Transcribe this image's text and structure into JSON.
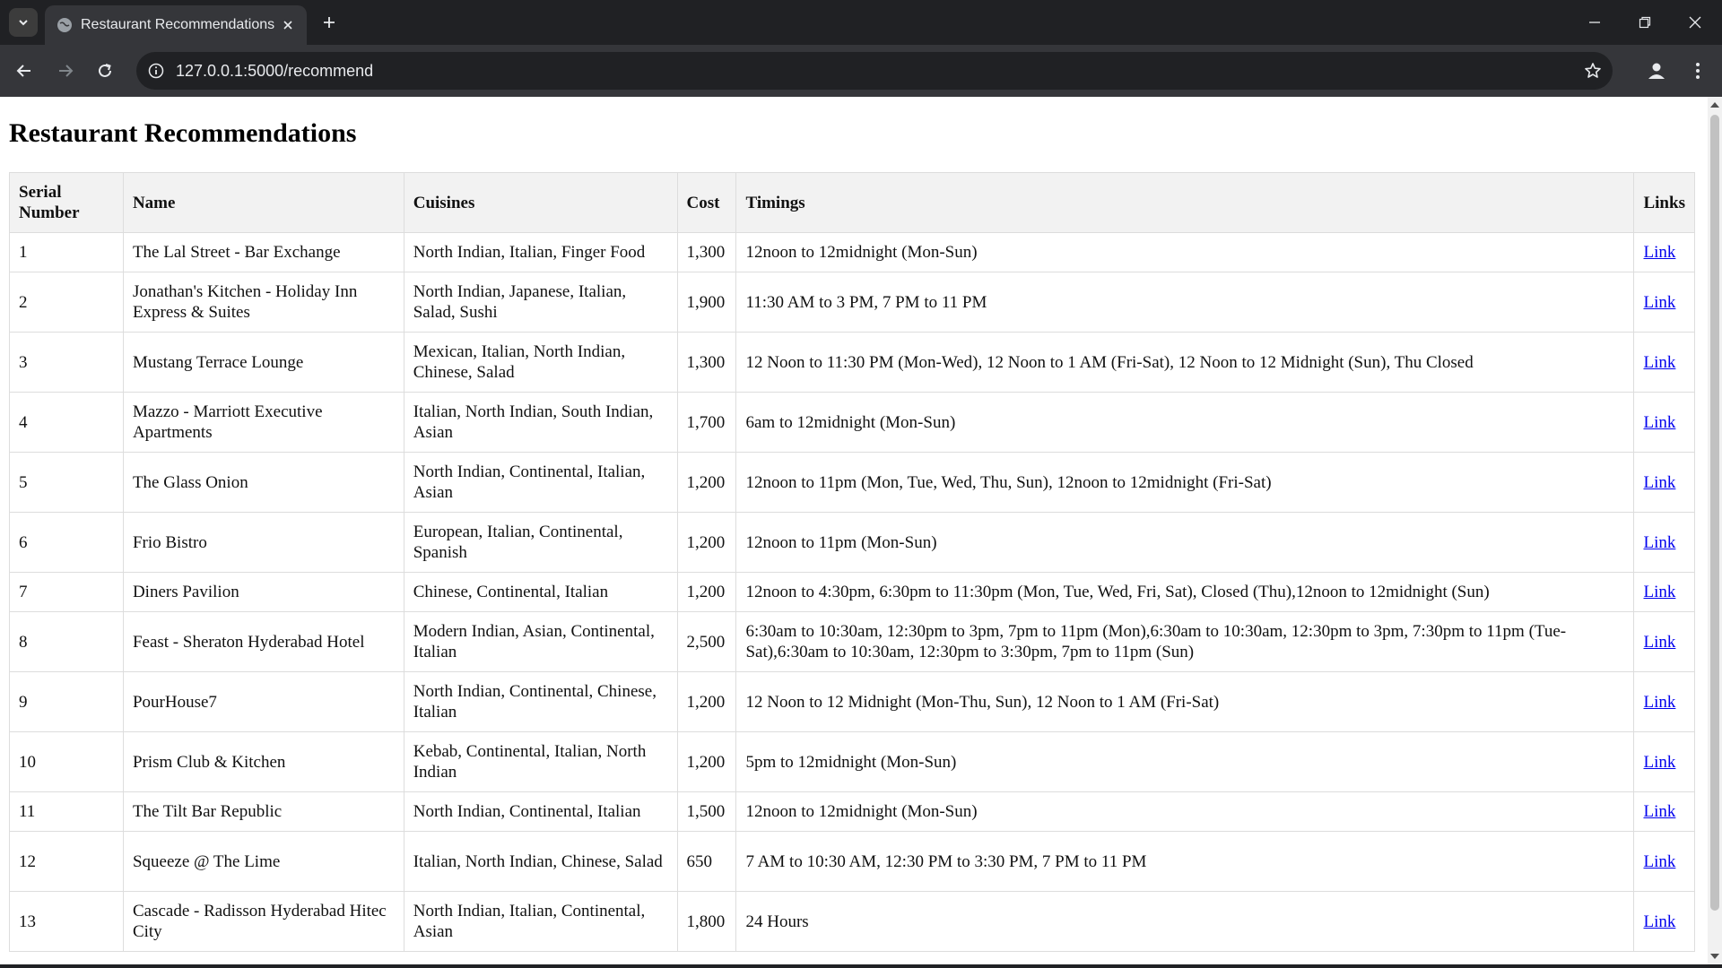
{
  "browser": {
    "tab_title": "Restaurant Recommendations",
    "url": "127.0.0.1:5000/recommend"
  },
  "page": {
    "title": "Restaurant Recommendations",
    "headers": {
      "serial": "Serial Number",
      "name": "Name",
      "cuisines": "Cuisines",
      "cost": "Cost",
      "timings": "Timings",
      "links": "Links"
    },
    "link_label": "Link",
    "rows": [
      {
        "serial": "1",
        "name": "The Lal Street - Bar Exchange",
        "cuisines": "North Indian, Italian, Finger Food",
        "cost": "1,300",
        "timings": "12noon to 12midnight (Mon-Sun)"
      },
      {
        "serial": "2",
        "name": "Jonathan's Kitchen - Holiday Inn Express & Suites",
        "cuisines": "North Indian, Japanese, Italian, Salad, Sushi",
        "cost": "1,900",
        "timings": "11:30 AM to 3 PM, 7 PM to 11 PM"
      },
      {
        "serial": "3",
        "name": "Mustang Terrace Lounge",
        "cuisines": "Mexican, Italian, North Indian, Chinese, Salad",
        "cost": "1,300",
        "timings": "12 Noon to 11:30 PM (Mon-Wed), 12 Noon to 1 AM (Fri-Sat), 12 Noon to 12 Midnight (Sun), Thu Closed"
      },
      {
        "serial": "4",
        "name": "Mazzo - Marriott Executive Apartments",
        "cuisines": "Italian, North Indian, South Indian, Asian",
        "cost": "1,700",
        "timings": "6am to 12midnight (Mon-Sun)"
      },
      {
        "serial": "5",
        "name": "The Glass Onion",
        "cuisines": "North Indian, Continental, Italian, Asian",
        "cost": "1,200",
        "timings": "12noon to 11pm (Mon, Tue, Wed, Thu, Sun), 12noon to 12midnight (Fri-Sat)"
      },
      {
        "serial": "6",
        "name": "Frio Bistro",
        "cuisines": "European, Italian, Continental, Spanish",
        "cost": "1,200",
        "timings": "12noon to 11pm (Mon-Sun)"
      },
      {
        "serial": "7",
        "name": "Diners Pavilion",
        "cuisines": "Chinese, Continental, Italian",
        "cost": "1,200",
        "timings": "12noon to 4:30pm, 6:30pm to 11:30pm (Mon, Tue, Wed, Fri, Sat), Closed (Thu),12noon to 12midnight (Sun)"
      },
      {
        "serial": "8",
        "name": "Feast - Sheraton Hyderabad Hotel",
        "cuisines": "Modern Indian, Asian, Continental, Italian",
        "cost": "2,500",
        "timings": "6:30am to 10:30am, 12:30pm to 3pm, 7pm to 11pm (Mon),6:30am to 10:30am, 12:30pm to 3pm, 7:30pm to 11pm (Tue-Sat),6:30am to 10:30am, 12:30pm to 3:30pm, 7pm to 11pm (Sun)"
      },
      {
        "serial": "9",
        "name": "PourHouse7",
        "cuisines": "North Indian, Continental, Chinese, Italian",
        "cost": "1,200",
        "timings": "12 Noon to 12 Midnight (Mon-Thu, Sun), 12 Noon to 1 AM (Fri-Sat)"
      },
      {
        "serial": "10",
        "name": "Prism Club & Kitchen",
        "cuisines": "Kebab, Continental, Italian, North Indian",
        "cost": "1,200",
        "timings": "5pm to 12midnight (Mon-Sun)"
      },
      {
        "serial": "11",
        "name": "The Tilt Bar Republic",
        "cuisines": "North Indian, Continental, Italian",
        "cost": "1,500",
        "timings": "12noon to 12midnight (Mon-Sun)"
      },
      {
        "serial": "12",
        "name": "Squeeze @ The Lime",
        "cuisines": "Italian, North Indian, Chinese, Salad",
        "cost": "650",
        "timings": "7 AM to 10:30 AM, 12:30 PM to 3:30 PM, 7 PM to 11 PM"
      },
      {
        "serial": "13",
        "name": "Cascade - Radisson Hyderabad Hitec City",
        "cuisines": "North Indian, Italian, Continental, Asian",
        "cost": "1,800",
        "timings": "24 Hours"
      }
    ]
  }
}
